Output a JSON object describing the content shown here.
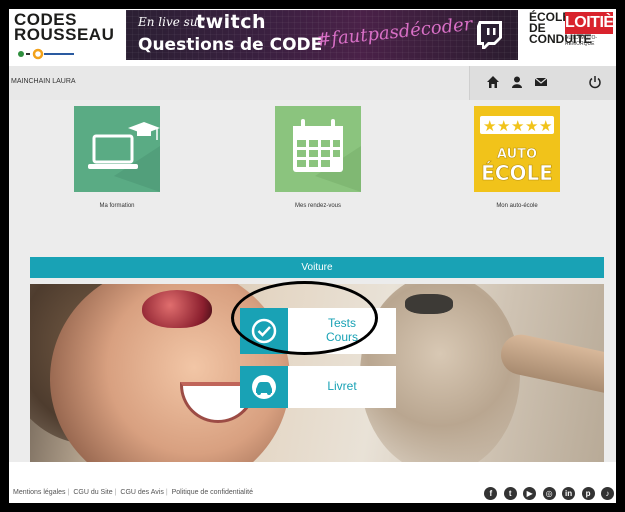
{
  "header": {
    "logo_left": {
      "line1": "CODES",
      "line2": "ROUSSEAU"
    },
    "banner": {
      "en_live": "En live sur",
      "twitch": "twitch",
      "questions": "Questions de CODE",
      "hashtag": "#fautpasdécoder"
    },
    "logo_right": {
      "left": "ÉCOLE DE CONDUITE",
      "right": "LOITIÈRE",
      "sub": "AUTO-MOTO-REMORQUE"
    }
  },
  "userbar": {
    "username": "MAINCHAIN LAURA",
    "icons": [
      "home-icon",
      "user-icon",
      "mail-icon",
      "power-icon"
    ]
  },
  "tiles": [
    {
      "label": "Ma formation",
      "icon": "laptop-graduation-icon",
      "color": "#5aab84"
    },
    {
      "label": "Mes rendez-vous",
      "icon": "calendar-icon",
      "color": "#8bc47e"
    },
    {
      "label": "Mon auto-école",
      "icon": "auto-ecole-rating-icon",
      "color": "#f1c31a",
      "badge_lines": [
        "AUTO",
        "ÉCOLE"
      ]
    }
  ],
  "voiture": {
    "title": "Voiture",
    "accent": "#19a2b5",
    "cards": [
      {
        "lines": [
          "Tests",
          "Cours"
        ],
        "icon": "check-circle-icon"
      },
      {
        "lines": [
          "Livret"
        ],
        "icon": "car-icon"
      }
    ]
  },
  "footer": {
    "links": [
      "Mentions légales",
      "CGU du Site",
      "CGU des Avis",
      "Politique de confidentialité"
    ],
    "social": [
      "facebook-icon",
      "twitter-icon",
      "youtube-icon",
      "instagram-icon",
      "linkedin-icon",
      "pinterest-icon",
      "tiktok-icon"
    ]
  }
}
